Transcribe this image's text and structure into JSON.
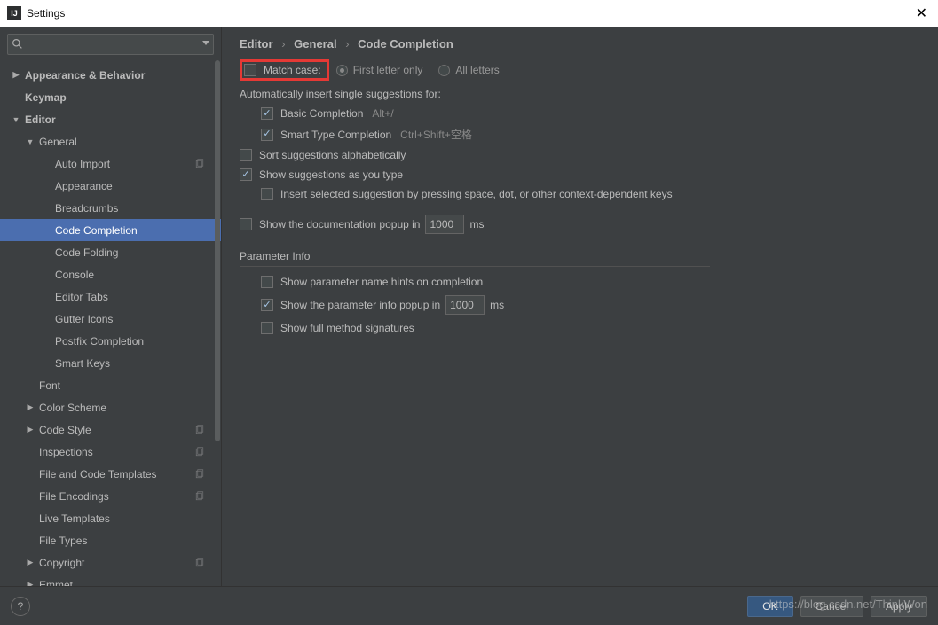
{
  "titlebar": {
    "title": "Settings",
    "app_initials": "IJ"
  },
  "search": {
    "placeholder": ""
  },
  "sidebar": {
    "items": [
      {
        "label": "Appearance & Behavior",
        "arrow": "▶",
        "indent": 0,
        "bold": true
      },
      {
        "label": "Keymap",
        "arrow": "",
        "indent": 0,
        "bold": true,
        "pad": true
      },
      {
        "label": "Editor",
        "arrow": "▼",
        "indent": 0,
        "bold": true
      },
      {
        "label": "General",
        "arrow": "▼",
        "indent": 1
      },
      {
        "label": "Auto Import",
        "arrow": "",
        "indent": 3,
        "copy": true
      },
      {
        "label": "Appearance",
        "arrow": "",
        "indent": 3
      },
      {
        "label": "Breadcrumbs",
        "arrow": "",
        "indent": 3
      },
      {
        "label": "Code Completion",
        "arrow": "",
        "indent": 3,
        "selected": true
      },
      {
        "label": "Code Folding",
        "arrow": "",
        "indent": 3
      },
      {
        "label": "Console",
        "arrow": "",
        "indent": 3
      },
      {
        "label": "Editor Tabs",
        "arrow": "",
        "indent": 3
      },
      {
        "label": "Gutter Icons",
        "arrow": "",
        "indent": 3
      },
      {
        "label": "Postfix Completion",
        "arrow": "",
        "indent": 3
      },
      {
        "label": "Smart Keys",
        "arrow": "",
        "indent": 3
      },
      {
        "label": "Font",
        "arrow": "",
        "indent": 1,
        "pad": true
      },
      {
        "label": "Color Scheme",
        "arrow": "▶",
        "indent": 1
      },
      {
        "label": "Code Style",
        "arrow": "▶",
        "indent": 1,
        "copy": true
      },
      {
        "label": "Inspections",
        "arrow": "",
        "indent": 1,
        "pad": true,
        "copy": true
      },
      {
        "label": "File and Code Templates",
        "arrow": "",
        "indent": 1,
        "pad": true,
        "copy": true
      },
      {
        "label": "File Encodings",
        "arrow": "",
        "indent": 1,
        "pad": true,
        "copy": true
      },
      {
        "label": "Live Templates",
        "arrow": "",
        "indent": 1,
        "pad": true
      },
      {
        "label": "File Types",
        "arrow": "",
        "indent": 1,
        "pad": true
      },
      {
        "label": "Copyright",
        "arrow": "▶",
        "indent": 1,
        "copy": true
      },
      {
        "label": "Emmet",
        "arrow": "▶",
        "indent": 1
      }
    ]
  },
  "breadcrumb": {
    "a": "Editor",
    "b": "General",
    "c": "Code Completion"
  },
  "matchcase": {
    "label": "Match case:",
    "opt1": "First letter only",
    "opt2": "All letters"
  },
  "autoinsert": {
    "heading": "Automatically insert single suggestions for:",
    "basic": "Basic Completion",
    "basic_sc": "Alt+/",
    "smart": "Smart Type Completion",
    "smart_sc": "Ctrl+Shift+空格"
  },
  "opts": {
    "sort": "Sort suggestions alphabetically",
    "show_type": "Show suggestions as you type",
    "insert_keys": "Insert selected suggestion by pressing space, dot, or other context-dependent keys",
    "doc_popup_pre": "Show the documentation popup in",
    "doc_popup_val": "1000",
    "ms": "ms"
  },
  "paraminfo": {
    "header": "Parameter Info",
    "hints": "Show parameter name hints on completion",
    "popup_pre": "Show the parameter info popup in",
    "popup_val": "1000",
    "popup_ms": "ms",
    "full_sig": "Show full method signatures"
  },
  "footer": {
    "ok": "OK",
    "cancel": "Cancel",
    "apply": "Apply"
  },
  "watermark": "https://blog.csdn.net/ThinkWon"
}
